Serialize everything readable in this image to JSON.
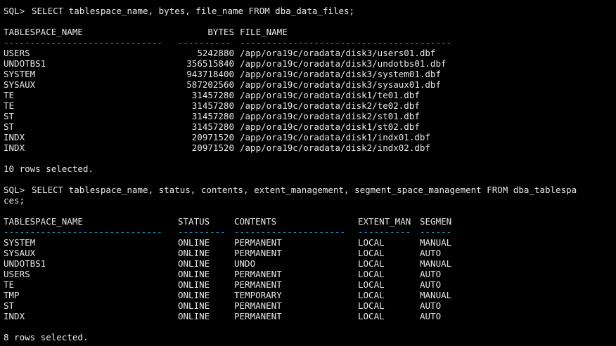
{
  "query1": {
    "prompt": "SQL>",
    "command": "SELECT tablespace_name, bytes, file_name FROM dba_data_files;",
    "columns": [
      "TABLESPACE_NAME",
      "BYTES",
      "FILE_NAME"
    ],
    "separators": [
      "------------------------------",
      "----------",
      "----------------------------------------"
    ],
    "rows": [
      [
        "USERS",
        "5242880",
        "/app/ora19c/oradata/disk3/users01.dbf"
      ],
      [
        "UNDOTBS1",
        "356515840",
        "/app/ora19c/oradata/disk3/undotbs01.dbf"
      ],
      [
        "SYSTEM",
        "943718400",
        "/app/ora19c/oradata/disk3/system01.dbf"
      ],
      [
        "SYSAUX",
        "587202560",
        "/app/ora19c/oradata/disk3/sysaux01.dbf"
      ],
      [
        "TE",
        "31457280",
        "/app/ora19c/oradata/disk1/te01.dbf"
      ],
      [
        "TE",
        "31457280",
        "/app/ora19c/oradata/disk2/te02.dbf"
      ],
      [
        "ST",
        "31457280",
        "/app/ora19c/oradata/disk2/st01.dbf"
      ],
      [
        "ST",
        "31457280",
        "/app/ora19c/oradata/disk1/st02.dbf"
      ],
      [
        "INDX",
        "20971520",
        "/app/ora19c/oradata/disk1/indx01.dbf"
      ],
      [
        "INDX",
        "20971520",
        "/app/ora19c/oradata/disk2/indx02.dbf"
      ]
    ],
    "footer": "10 rows selected."
  },
  "query2": {
    "prompt": "SQL>",
    "command_line1": "SELECT tablespace_name, status, contents, extent_management, segment_space_management FROM dba_tablespa",
    "command_line2": "ces;",
    "columns": [
      "TABLESPACE_NAME",
      "STATUS",
      "CONTENTS",
      "EXTENT_MAN",
      "SEGMEN"
    ],
    "separators": [
      "------------------------------",
      "---------",
      "---------------------",
      "----------",
      "------"
    ],
    "rows": [
      [
        "SYSTEM",
        "ONLINE",
        "PERMANENT",
        "LOCAL",
        "MANUAL"
      ],
      [
        "SYSAUX",
        "ONLINE",
        "PERMANENT",
        "LOCAL",
        "AUTO"
      ],
      [
        "UNDOTBS1",
        "ONLINE",
        "UNDO",
        "LOCAL",
        "MANUAL"
      ],
      [
        "USERS",
        "ONLINE",
        "PERMANENT",
        "LOCAL",
        "AUTO"
      ],
      [
        "TE",
        "ONLINE",
        "PERMANENT",
        "LOCAL",
        "AUTO"
      ],
      [
        "TMP",
        "ONLINE",
        "TEMPORARY",
        "LOCAL",
        "MANUAL"
      ],
      [
        "ST",
        "ONLINE",
        "PERMANENT",
        "LOCAL",
        "AUTO"
      ],
      [
        "INDX",
        "ONLINE",
        "PERMANENT",
        "LOCAL",
        "AUTO"
      ]
    ],
    "footer": "8 rows selected."
  },
  "colors": {
    "background": "#000000",
    "text": "#e8e8e8",
    "separator": "#2ea8d8"
  }
}
